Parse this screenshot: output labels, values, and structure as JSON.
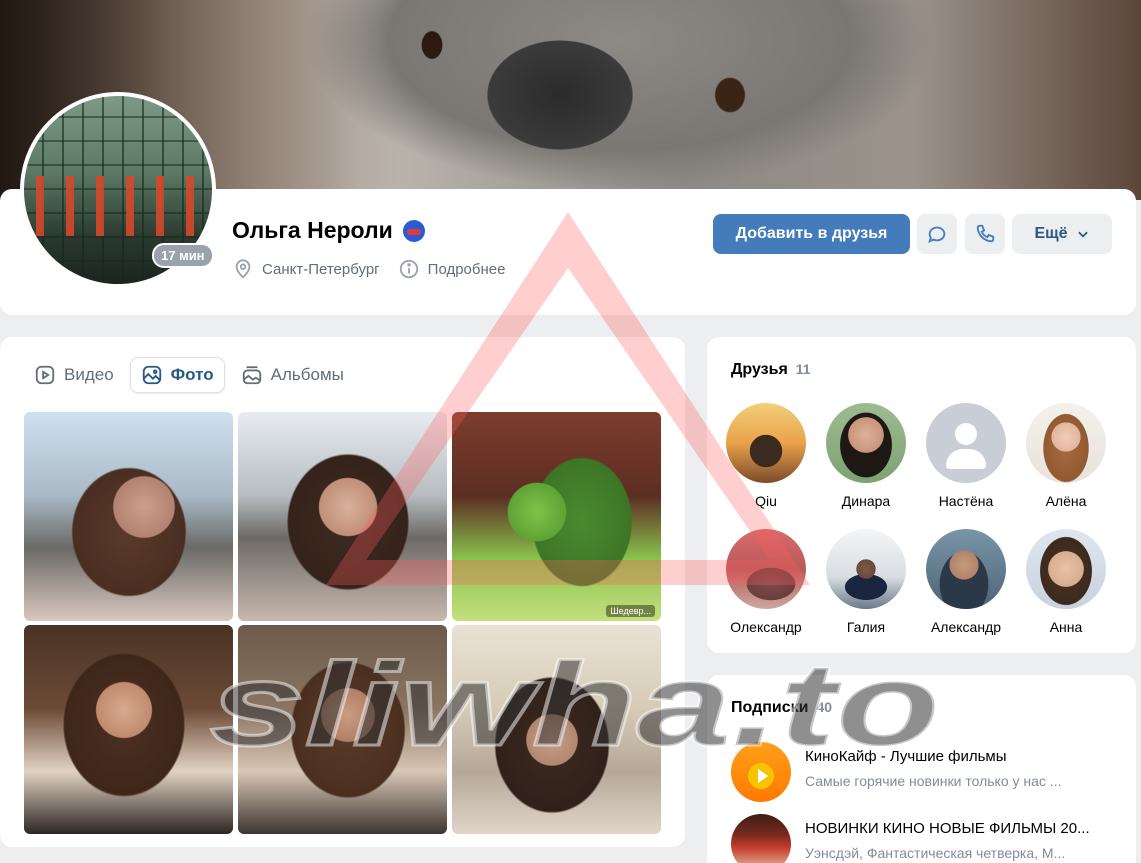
{
  "profile": {
    "name": "Ольга Нероли",
    "online_time": "17 мин",
    "city": "Санкт-Петербург",
    "more_info": "Подробнее"
  },
  "actions": {
    "add_friend": "Добавить в друзья",
    "more": "Ещё"
  },
  "media_tabs": [
    {
      "label": "Видео",
      "icon": "video-icon"
    },
    {
      "label": "Фото",
      "icon": "photo-icon",
      "active": true
    },
    {
      "label": "Альбомы",
      "icon": "albums-icon"
    }
  ],
  "photos": [
    {
      "name": "photo-1"
    },
    {
      "name": "photo-2"
    },
    {
      "name": "photo-3"
    },
    {
      "name": "photo-4"
    },
    {
      "name": "photo-5"
    },
    {
      "name": "photo-6"
    }
  ],
  "photo_watermark": "Шедевр...",
  "friends": {
    "title": "Друзья",
    "count": "11",
    "items": [
      {
        "name": "Qiu"
      },
      {
        "name": "Динара"
      },
      {
        "name": "Настёна"
      },
      {
        "name": "Алёна"
      },
      {
        "name": "Олександр"
      },
      {
        "name": "Галия"
      },
      {
        "name": "Александр"
      },
      {
        "name": "Анна"
      }
    ]
  },
  "subscriptions": {
    "title": "Подписки",
    "count": "40",
    "items": [
      {
        "title": "КиноКайф - Лучшие фильмы",
        "desc": "Самые горячие новинки только у нас ..."
      },
      {
        "title": "НОВИНКИ КИНО НОВЫЕ ФИЛЬМЫ 20...",
        "desc": "Уэнсдэй, Фантастическая четверка, М..."
      }
    ]
  },
  "watermark": {
    "text": "sliwha.to",
    "colors": {
      "triangle": "#ff6b6b",
      "text": "#333333"
    }
  },
  "colors": {
    "primary_button": "#447bba",
    "link": "#2a5885",
    "secondary_text": "#626d7a",
    "page_bg": "#edeef0"
  }
}
